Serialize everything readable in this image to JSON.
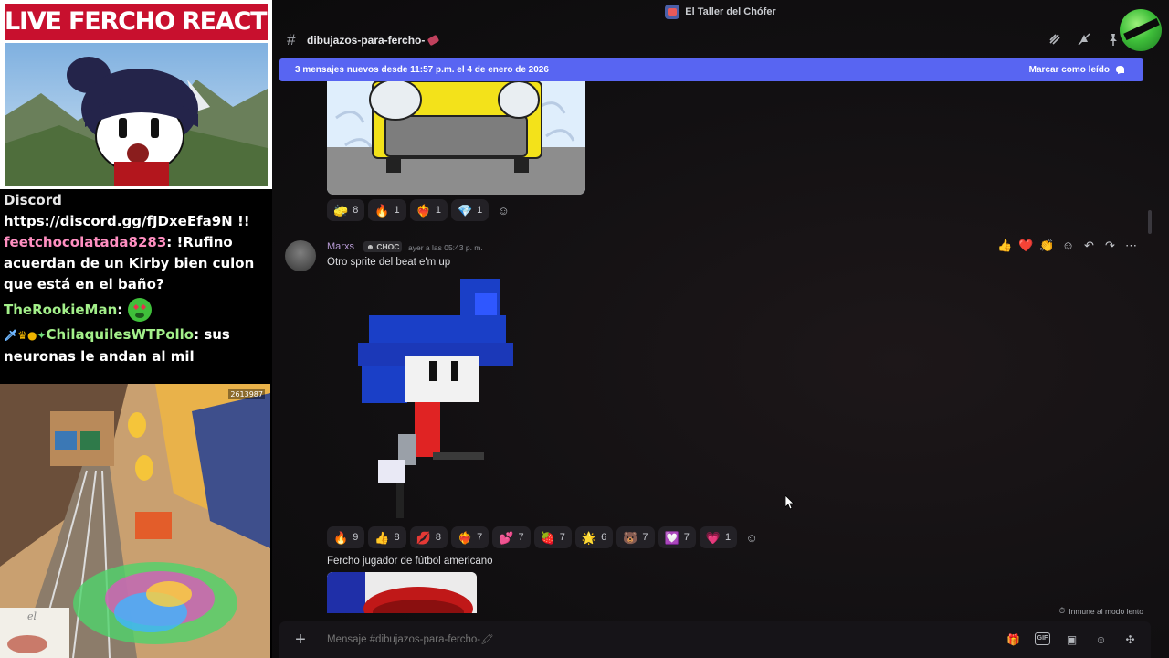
{
  "stream": {
    "banner_title": "LIVE FERCHO REACTION",
    "chat": [
      {
        "user": "Discord",
        "user_color": "#e6e6e6",
        "text": "",
        "plain": true
      },
      {
        "user": "",
        "user_color": "#ffffff",
        "text": "https://discord.gg/fJDxeEfa9N !!"
      },
      {
        "user": "feetchocolatada8283",
        "user_color": "#ff8fc1",
        "text": ": !Rufino acuerdan de un Kirby bien culon que está en el baño?"
      },
      {
        "user": "TheRookieMan",
        "user_color": "#a3f08a",
        "text": ": "
      },
      {
        "user": "ChilaquilesWTPollo",
        "user_color": "#a3f08a",
        "text": ": sus neuronas le andan al mil"
      }
    ],
    "game_counter": "2613987",
    "overlay_text": "el"
  },
  "discord": {
    "server_name": "El Taller del Chófer",
    "channel_name": "dibujazos-para-fercho-",
    "new_messages_bar": {
      "text": "3 mensajes nuevos desde 11:57 p.m. el 4 de enero de 2026",
      "mark_read": "Marcar como leído"
    },
    "message1_reactions": [
      {
        "emoji": "🧽",
        "count": "8"
      },
      {
        "emoji": "🔥",
        "count": "1"
      },
      {
        "emoji": "❤️‍🔥",
        "count": "1"
      },
      {
        "emoji": "💎",
        "count": "1"
      }
    ],
    "message2": {
      "author": "Marxs",
      "author_color": "#b99cd7",
      "tag": "CHOC",
      "timestamp": "ayer a las 05:43 p. m.",
      "text": "Otro sprite del beat e'm up",
      "reactions": [
        {
          "emoji": "🔥",
          "count": "9"
        },
        {
          "emoji": "👍",
          "count": "8"
        },
        {
          "emoji": "💋",
          "count": "8"
        },
        {
          "emoji": "❤️‍🔥",
          "count": "7"
        },
        {
          "emoji": "💕",
          "count": "7"
        },
        {
          "emoji": "🍓",
          "count": "7"
        },
        {
          "emoji": "🌟",
          "count": "6"
        },
        {
          "emoji": "🐻",
          "count": "7"
        },
        {
          "emoji": "💟",
          "count": "7"
        },
        {
          "emoji": "💗",
          "count": "1"
        }
      ],
      "hover_actions": [
        "👍",
        "❤️",
        "👏"
      ]
    },
    "message3": {
      "text": "Fercho jugador de fútbol americano"
    },
    "slowmode_text": "Inmune al modo lento",
    "composer_placeholder": "Mensaje #dibujazos-para-fercho-🖍"
  }
}
